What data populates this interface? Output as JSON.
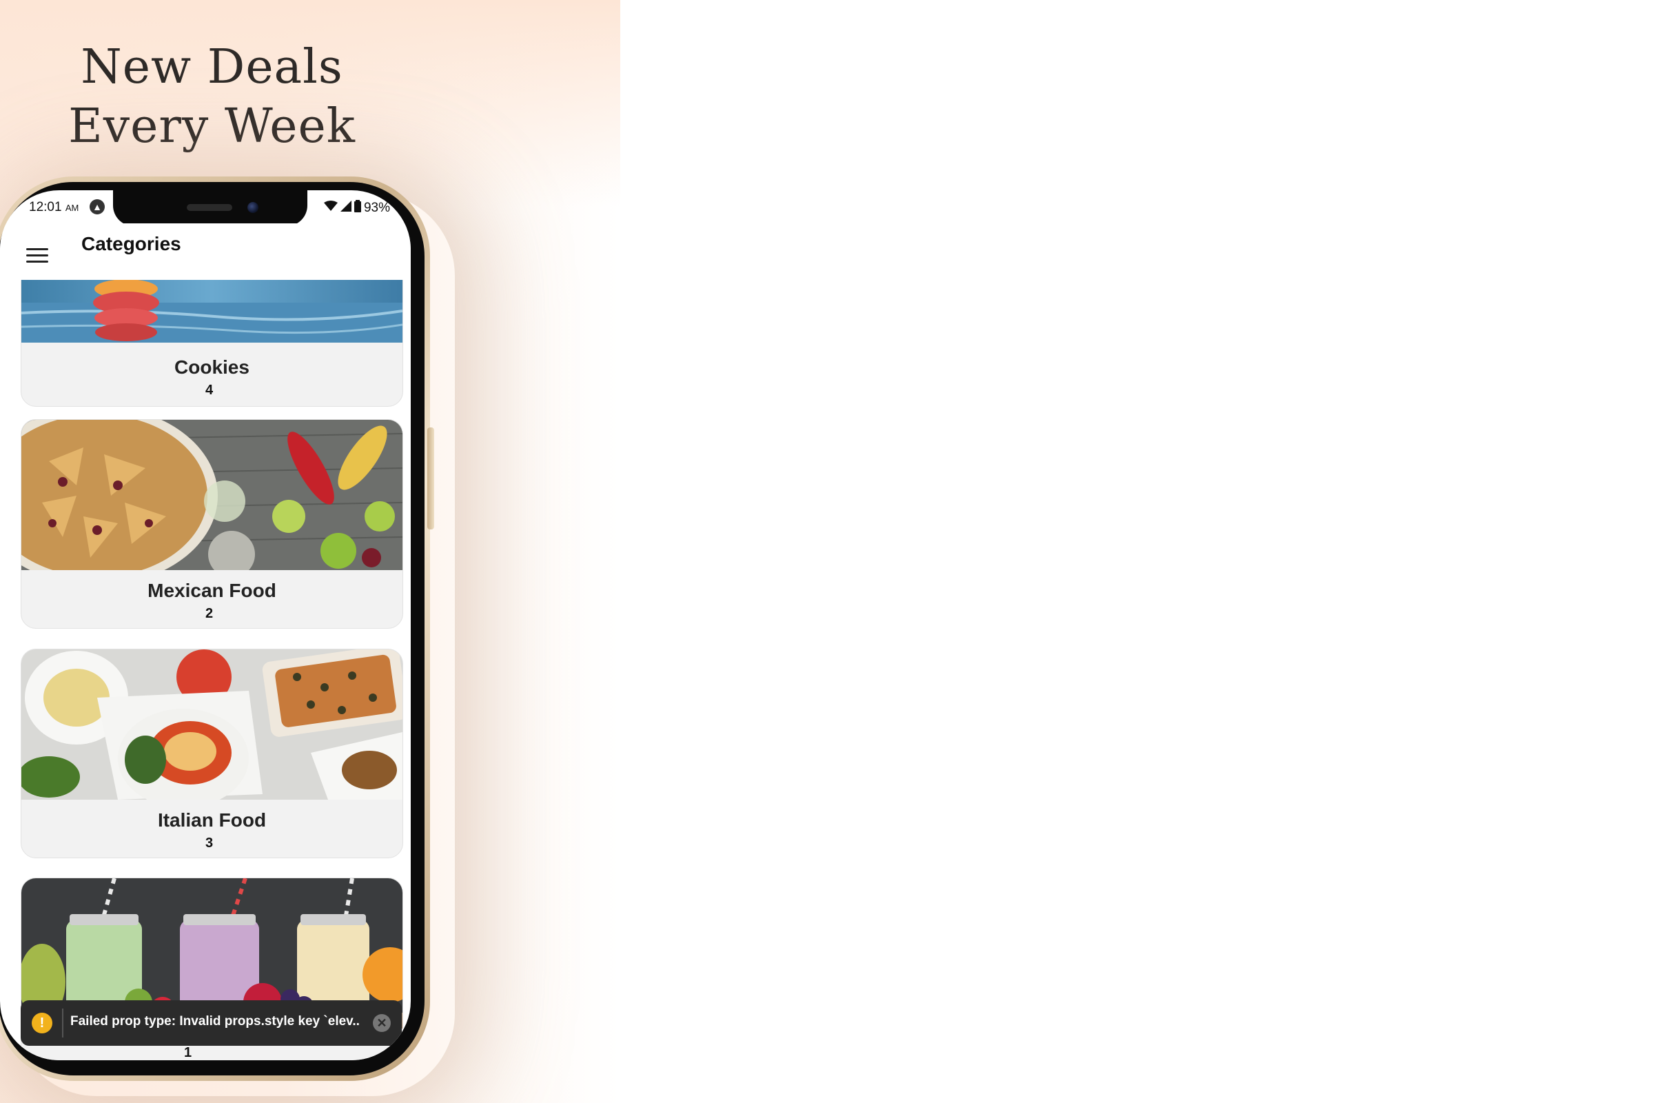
{
  "headline": {
    "line1": "New Deals",
    "line2": "Every Week"
  },
  "status_bar": {
    "time": "12:01",
    "ampm": "AM",
    "battery": "93%"
  },
  "app_bar": {
    "title": "Categories"
  },
  "categories": [
    {
      "name": "Cookies",
      "count": "4"
    },
    {
      "name": "Mexican Food",
      "count": "2"
    },
    {
      "name": "Italian Food",
      "count": "3"
    },
    {
      "name": "",
      "count": "1"
    }
  ],
  "toast": {
    "message": "Failed prop type: Invalid props.style key `elev..."
  },
  "colors": {
    "accent_warning": "#f2b21c",
    "toast_bg": "#2b2b2b",
    "card_bg": "#f2f2f2"
  }
}
